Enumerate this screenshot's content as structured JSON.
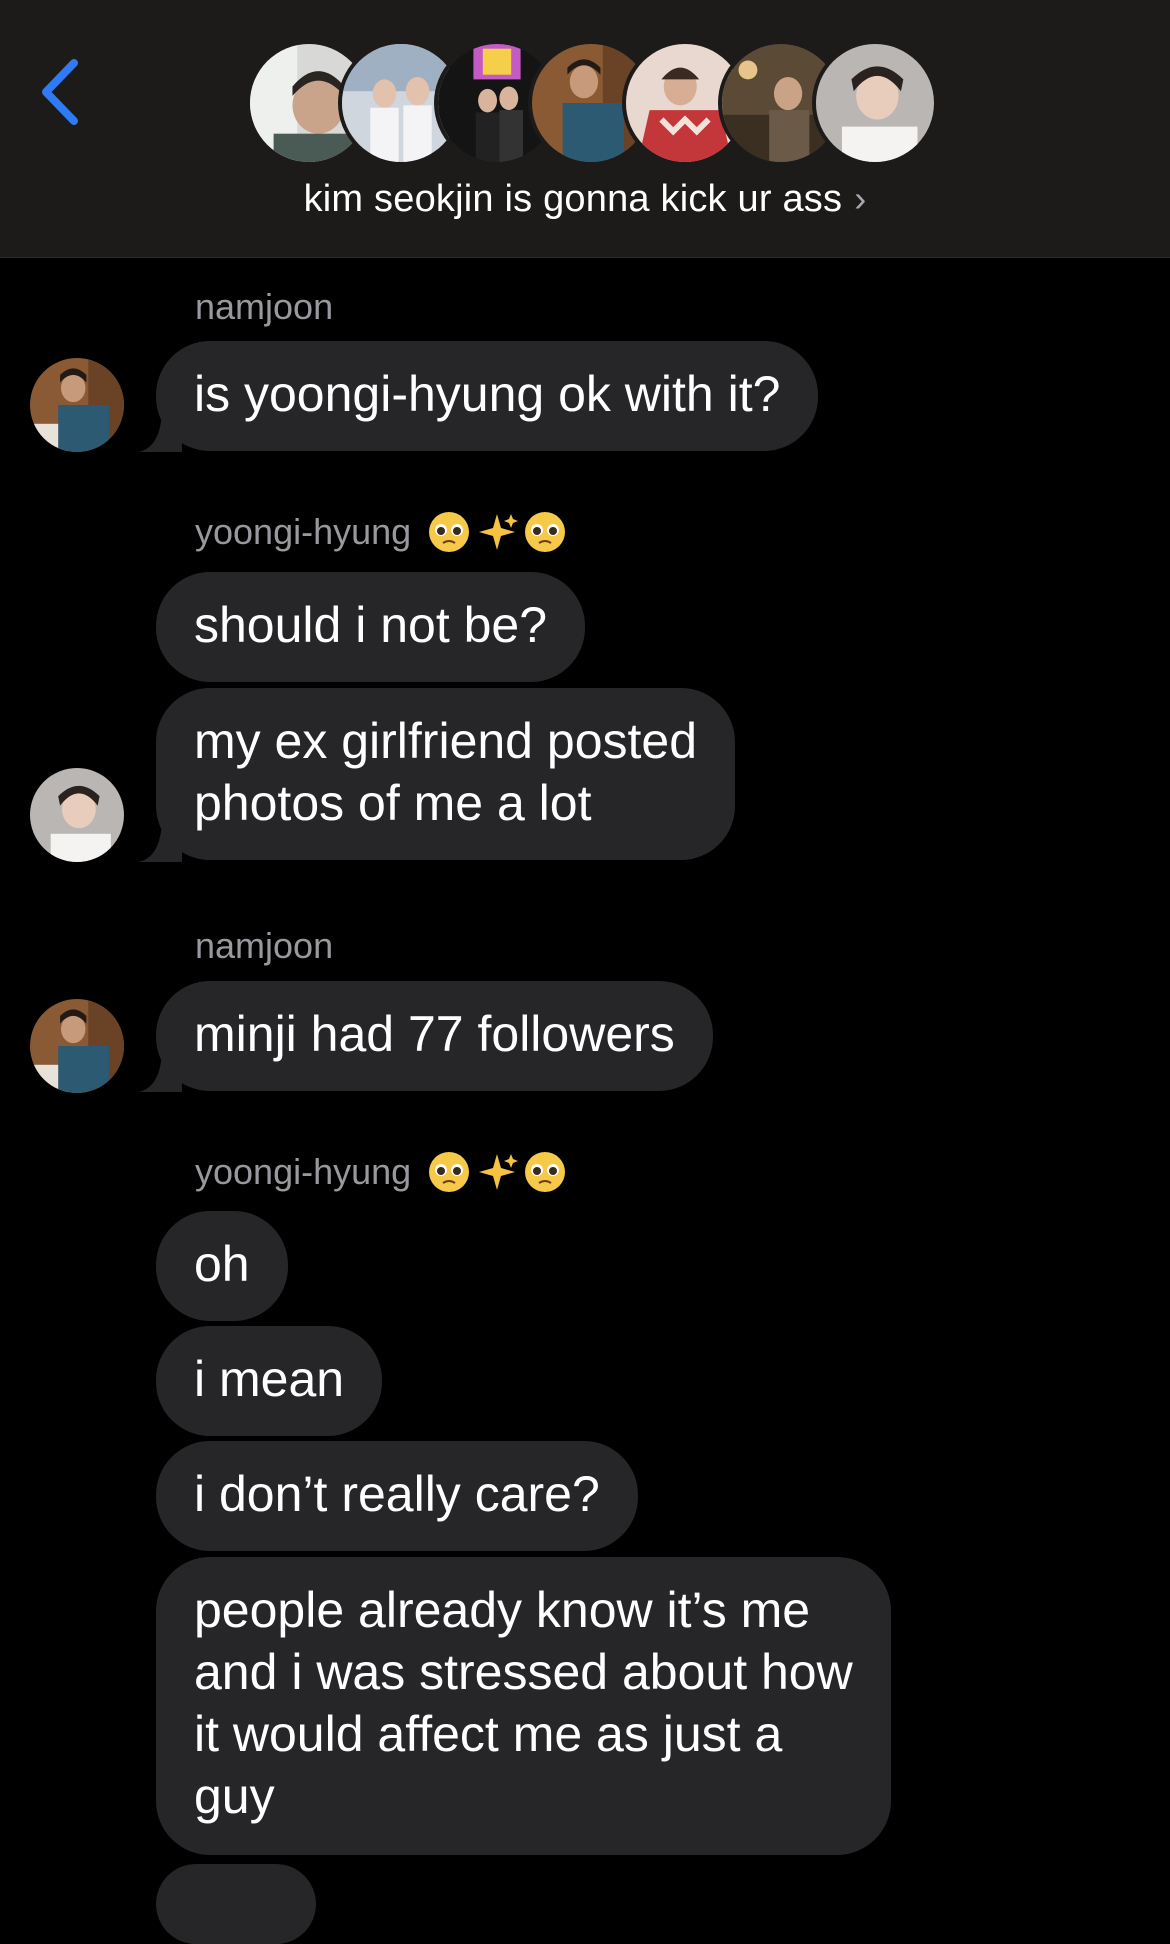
{
  "header": {
    "group_title": "kim seokjin is gonna kick ur ass",
    "group_chevron": "›",
    "back_icon": "chevron-left-icon",
    "accent_color": "#2f7bf5"
  },
  "messages": [
    {
      "sender": "namjoon",
      "bubbles": [
        "is yoongi-hyung ok with it?"
      ]
    },
    {
      "sender": "yoongi-hyung",
      "sender_emojis": [
        "pleading-face-emoji",
        "sparkles-emoji",
        "pleading-face-emoji"
      ],
      "bubbles": [
        "should i not be?",
        "my ex girlfriend posted\nphotos of me a lot"
      ]
    },
    {
      "sender": "namjoon",
      "bubbles": [
        "minji had 77 followers"
      ]
    },
    {
      "sender": "yoongi-hyung",
      "sender_emojis": [
        "pleading-face-emoji",
        "sparkles-emoji",
        "pleading-face-emoji"
      ],
      "bubbles": [
        "oh",
        "i mean",
        "i don’t really care?",
        "people already know it’s me\nand i was stressed about how\nit would affect me as just a\nguy"
      ]
    }
  ],
  "colors": {
    "bubble": "#262628",
    "header_bg": "#1c1b1a",
    "sender_label": "#98989e"
  }
}
